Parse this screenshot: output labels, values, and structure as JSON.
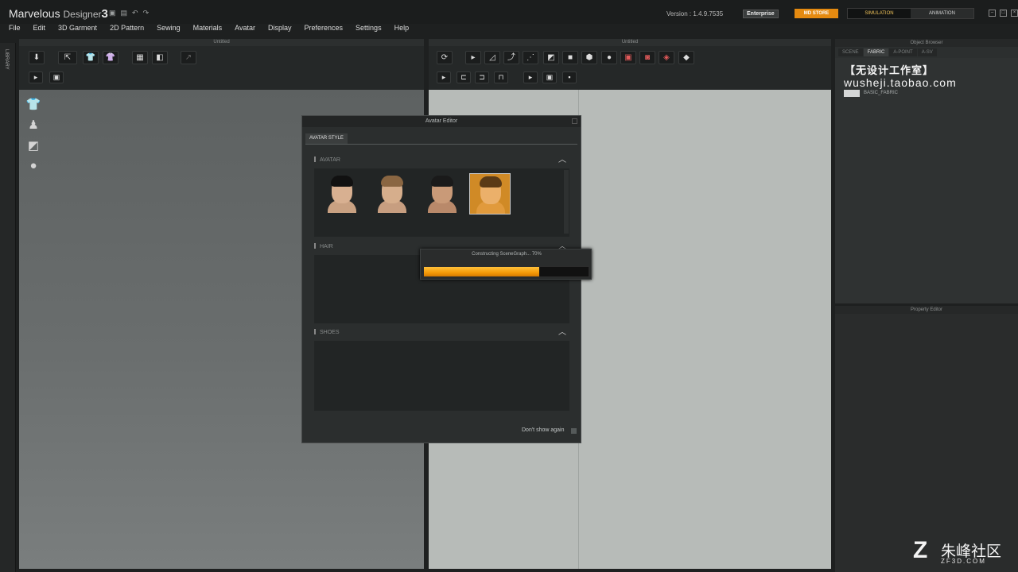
{
  "app": {
    "logo_main": "Marvelous",
    "logo_sub": "Designer",
    "logo_num": "3",
    "version": "Version : 1.4.9.7535",
    "edition": "Enterprise",
    "store": "MD STORE",
    "mode_simulation": "SIMULATION",
    "mode_animation": "ANIMATION"
  },
  "menu": [
    "File",
    "Edit",
    "3D Garment",
    "2D Pattern",
    "Sewing",
    "Materials",
    "Avatar",
    "Display",
    "Preferences",
    "Settings",
    "Help"
  ],
  "library_label": "LIBRARY",
  "view3d": {
    "title": "Untitled"
  },
  "view2d": {
    "title": "Untitled"
  },
  "object_browser": {
    "title": "Object Browser",
    "tabs": [
      "SCENE",
      "FABRIC",
      "A-POINT",
      "A-SV"
    ],
    "active_tab": "FABRIC",
    "fabric_name": "BASIC_FABRIC"
  },
  "property_editor": {
    "title": "Property Editor"
  },
  "watermark": {
    "line1": "【无设计工作室】",
    "line2": "wusheji.taobao.com"
  },
  "dialog": {
    "title": "Avatar Editor",
    "tab": "AVATAR STYLE",
    "sections": {
      "avatar": "AVATAR",
      "hair": "HAIR",
      "shoes": "SHOES"
    },
    "dont_show": "Don't show again"
  },
  "progress": {
    "text": "Constructing SceneGraph... 70%",
    "value": 0.7
  },
  "corner_logo": {
    "cn": "朱峰社区",
    "en": "ZF3D.COM"
  },
  "colors": {
    "accent": "#f59a08",
    "store": "#e58a10"
  }
}
